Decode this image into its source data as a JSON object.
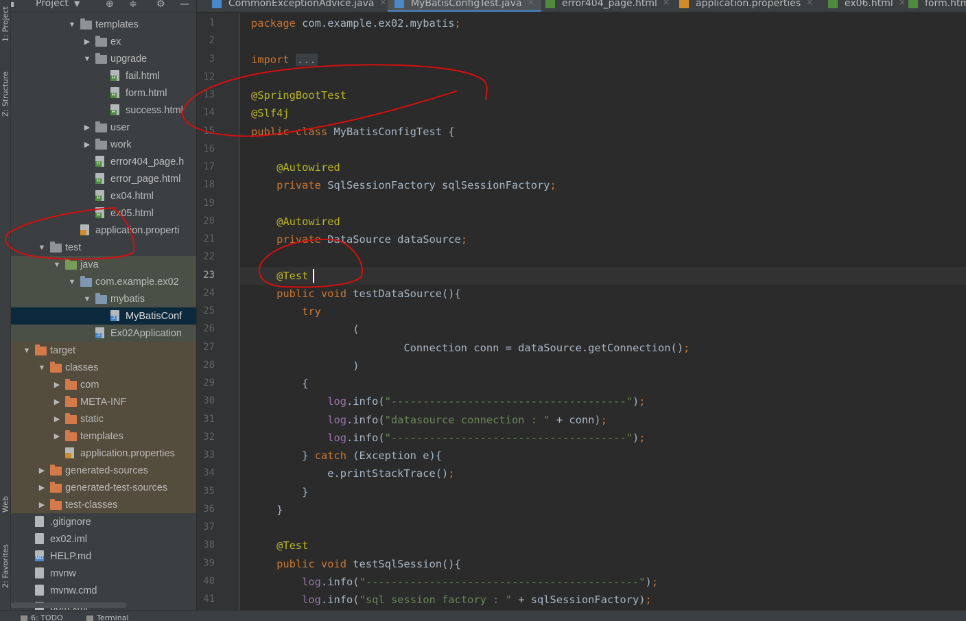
{
  "side_tabs": {
    "project": "1: Project",
    "structure": "Z: Structure",
    "web": "Web",
    "favorites": "2: Favorites"
  },
  "project_panel": {
    "title": "Project",
    "tree": [
      {
        "label": "templates",
        "depth": 4,
        "arrow": "open",
        "icon": "folder"
      },
      {
        "label": "ex",
        "depth": 5,
        "arrow": "closed",
        "icon": "folder"
      },
      {
        "label": "upgrade",
        "depth": 5,
        "arrow": "open",
        "icon": "folder"
      },
      {
        "label": "fail.html",
        "depth": 6,
        "arrow": "",
        "icon": "html"
      },
      {
        "label": "form.html",
        "depth": 6,
        "arrow": "",
        "icon": "html"
      },
      {
        "label": "success.html",
        "depth": 6,
        "arrow": "",
        "icon": "html"
      },
      {
        "label": "user",
        "depth": 5,
        "arrow": "closed",
        "icon": "folder"
      },
      {
        "label": "work",
        "depth": 5,
        "arrow": "closed",
        "icon": "folder"
      },
      {
        "label": "error404_page.h",
        "depth": 5,
        "arrow": "",
        "icon": "html"
      },
      {
        "label": "error_page.html",
        "depth": 5,
        "arrow": "",
        "icon": "html"
      },
      {
        "label": "ex04.html",
        "depth": 5,
        "arrow": "",
        "icon": "html"
      },
      {
        "label": "ex05.html",
        "depth": 5,
        "arrow": "",
        "icon": "html"
      },
      {
        "label": "application.properti",
        "depth": 4,
        "arrow": "",
        "icon": "props"
      },
      {
        "label": "test",
        "depth": 2,
        "arrow": "open",
        "icon": "folder"
      },
      {
        "label": "java",
        "depth": 3,
        "arrow": "open",
        "icon": "folder-green",
        "band": "green"
      },
      {
        "label": "com.example.ex02",
        "depth": 4,
        "arrow": "open",
        "icon": "folder-blue",
        "band": "green"
      },
      {
        "label": "mybatis",
        "depth": 5,
        "arrow": "open",
        "icon": "folder-blue",
        "band": "green"
      },
      {
        "label": "MyBatisConf",
        "depth": 6,
        "arrow": "",
        "icon": "java",
        "band": "selected"
      },
      {
        "label": "Ex02Application",
        "depth": 5,
        "arrow": "",
        "icon": "java",
        "band": "green"
      },
      {
        "label": "target",
        "depth": 1,
        "arrow": "open",
        "icon": "folder-orange",
        "band": "brown"
      },
      {
        "label": "classes",
        "depth": 2,
        "arrow": "open",
        "icon": "folder-orange",
        "band": "brown"
      },
      {
        "label": "com",
        "depth": 3,
        "arrow": "closed",
        "icon": "folder-orange",
        "band": "brown"
      },
      {
        "label": "META-INF",
        "depth": 3,
        "arrow": "closed",
        "icon": "folder-orange",
        "band": "brown"
      },
      {
        "label": "static",
        "depth": 3,
        "arrow": "closed",
        "icon": "folder-orange",
        "band": "brown"
      },
      {
        "label": "templates",
        "depth": 3,
        "arrow": "closed",
        "icon": "folder-orange",
        "band": "brown"
      },
      {
        "label": "application.properties",
        "depth": 3,
        "arrow": "",
        "icon": "props",
        "band": "brown"
      },
      {
        "label": "generated-sources",
        "depth": 2,
        "arrow": "closed",
        "icon": "folder-orange",
        "band": "brown"
      },
      {
        "label": "generated-test-sources",
        "depth": 2,
        "arrow": "closed",
        "icon": "folder-orange",
        "band": "brown"
      },
      {
        "label": "test-classes",
        "depth": 2,
        "arrow": "closed",
        "icon": "folder-orange",
        "band": "brown"
      },
      {
        "label": ".gitignore",
        "depth": 1,
        "arrow": "",
        "icon": "file"
      },
      {
        "label": "ex02.iml",
        "depth": 1,
        "arrow": "",
        "icon": "file"
      },
      {
        "label": "HELP.md",
        "depth": 1,
        "arrow": "",
        "icon": "md"
      },
      {
        "label": "mvnw",
        "depth": 1,
        "arrow": "",
        "icon": "file"
      },
      {
        "label": "mvnw.cmd",
        "depth": 1,
        "arrow": "",
        "icon": "file"
      },
      {
        "label": "pom.xml",
        "depth": 1,
        "arrow": "",
        "icon": "file"
      }
    ]
  },
  "editor_tabs": [
    {
      "label": "CommonExceptionAdvice.java",
      "icon": "java",
      "active": false
    },
    {
      "label": "MyBatisConfigTest.java",
      "icon": "java",
      "active": true
    },
    {
      "label": "error404_page.html",
      "icon": "html",
      "active": false
    },
    {
      "label": "application.properties",
      "icon": "props",
      "active": false
    },
    {
      "label": "ex06.html",
      "icon": "html",
      "active": false
    },
    {
      "label": "form.html",
      "icon": "html",
      "active": false
    }
  ],
  "editor": {
    "current_line": "23",
    "lines": [
      {
        "n": "1",
        "tokens": [
          [
            "kw",
            "package "
          ],
          [
            "",
            "com.example.ex02.mybatis"
          ],
          [
            "kw",
            ";"
          ]
        ]
      },
      {
        "n": "2",
        "tokens": []
      },
      {
        "n": "3",
        "tokens": [
          [
            "kw",
            "import "
          ],
          [
            "fold",
            "..."
          ]
        ]
      },
      {
        "n": "12",
        "tokens": []
      },
      {
        "n": "13",
        "tokens": [
          [
            "an",
            "@SpringBootTest"
          ]
        ]
      },
      {
        "n": "14",
        "tokens": [
          [
            "an",
            "@Slf4j"
          ]
        ]
      },
      {
        "n": "15",
        "tokens": [
          [
            "kw",
            "public class "
          ],
          [
            "",
            "MyBatisConfigTest {"
          ]
        ]
      },
      {
        "n": "16",
        "tokens": []
      },
      {
        "n": "17",
        "tokens": [
          [
            "",
            "    "
          ],
          [
            "an",
            "@Autowired"
          ]
        ]
      },
      {
        "n": "18",
        "tokens": [
          [
            "",
            "    "
          ],
          [
            "kw",
            "private "
          ],
          [
            "",
            "SqlSessionFactory "
          ],
          [
            "",
            "sqlSessionFactory"
          ],
          [
            "kw",
            ";"
          ]
        ]
      },
      {
        "n": "19",
        "tokens": []
      },
      {
        "n": "20",
        "tokens": [
          [
            "",
            "    "
          ],
          [
            "an",
            "@Autowired"
          ]
        ]
      },
      {
        "n": "21",
        "tokens": [
          [
            "",
            "    "
          ],
          [
            "kw",
            "private "
          ],
          [
            "",
            "DataSource "
          ],
          [
            "",
            "dataSource"
          ],
          [
            "kw",
            ";"
          ]
        ]
      },
      {
        "n": "22",
        "tokens": []
      },
      {
        "n": "23",
        "tokens": [
          [
            "",
            "    "
          ],
          [
            "an",
            "@Test"
          ]
        ]
      },
      {
        "n": "24",
        "tokens": [
          [
            "",
            "    "
          ],
          [
            "kw",
            "public void "
          ],
          [
            "",
            "testDataSource(){"
          ]
        ]
      },
      {
        "n": "25",
        "tokens": [
          [
            "",
            "        "
          ],
          [
            "kw",
            "try"
          ]
        ]
      },
      {
        "n": "26",
        "tokens": [
          [
            "",
            "                ("
          ]
        ]
      },
      {
        "n": "27",
        "tokens": [
          [
            "",
            "                        Connection conn = dataSource.getConnection()"
          ],
          [
            "kw",
            ";"
          ]
        ]
      },
      {
        "n": "28",
        "tokens": [
          [
            "",
            "                )"
          ]
        ]
      },
      {
        "n": "29",
        "tokens": [
          [
            "",
            "        {"
          ]
        ]
      },
      {
        "n": "30",
        "tokens": [
          [
            "",
            "            "
          ],
          [
            "fld",
            "log"
          ],
          [
            "",
            ".info("
          ],
          [
            "st",
            "\"-------------------------------------\""
          ],
          [
            "",
            ")"
          ],
          [
            "kw",
            ";"
          ]
        ]
      },
      {
        "n": "31",
        "tokens": [
          [
            "",
            "            "
          ],
          [
            "fld",
            "log"
          ],
          [
            "",
            ".info("
          ],
          [
            "st",
            "\"datasource connection : \""
          ],
          [
            "",
            " + conn)"
          ],
          [
            "kw",
            ";"
          ]
        ]
      },
      {
        "n": "32",
        "tokens": [
          [
            "",
            "            "
          ],
          [
            "fld",
            "log"
          ],
          [
            "",
            ".info("
          ],
          [
            "st",
            "\"-------------------------------------\""
          ],
          [
            "",
            ")"
          ],
          [
            "kw",
            ";"
          ]
        ]
      },
      {
        "n": "33",
        "tokens": [
          [
            "",
            "        } "
          ],
          [
            "kw",
            "catch "
          ],
          [
            "",
            "(Exception e){"
          ]
        ]
      },
      {
        "n": "34",
        "tokens": [
          [
            "",
            "            e.printStackTrace()"
          ],
          [
            "kw",
            ";"
          ]
        ]
      },
      {
        "n": "35",
        "tokens": [
          [
            "",
            "        }"
          ]
        ]
      },
      {
        "n": "36",
        "tokens": [
          [
            "",
            "    }"
          ]
        ]
      },
      {
        "n": "37",
        "tokens": []
      },
      {
        "n": "38",
        "tokens": [
          [
            "",
            "    "
          ],
          [
            "an",
            "@Test"
          ]
        ]
      },
      {
        "n": "39",
        "tokens": [
          [
            "",
            "    "
          ],
          [
            "kw",
            "public void "
          ],
          [
            "",
            "testSqlSession(){"
          ]
        ]
      },
      {
        "n": "40",
        "tokens": [
          [
            "",
            "        "
          ],
          [
            "fld",
            "log"
          ],
          [
            "",
            ".info("
          ],
          [
            "st",
            "\"-------------------------------------------\""
          ],
          [
            "",
            ")"
          ],
          [
            "kw",
            ";"
          ]
        ]
      },
      {
        "n": "41",
        "tokens": [
          [
            "",
            "        "
          ],
          [
            "fld",
            "log"
          ],
          [
            "",
            ".info("
          ],
          [
            "st",
            "\"sql session factory : \""
          ],
          [
            "",
            " + sqlSessionFactory)"
          ],
          [
            "kw",
            ";"
          ]
        ]
      }
    ]
  },
  "bottom_tabs": {
    "todo": "6: TODO",
    "terminal": "Terminal"
  },
  "colors": {
    "annotation_red": "#d40f0f",
    "keyword": "#cc7832",
    "annotation": "#bbb529",
    "string": "#6a8759"
  }
}
